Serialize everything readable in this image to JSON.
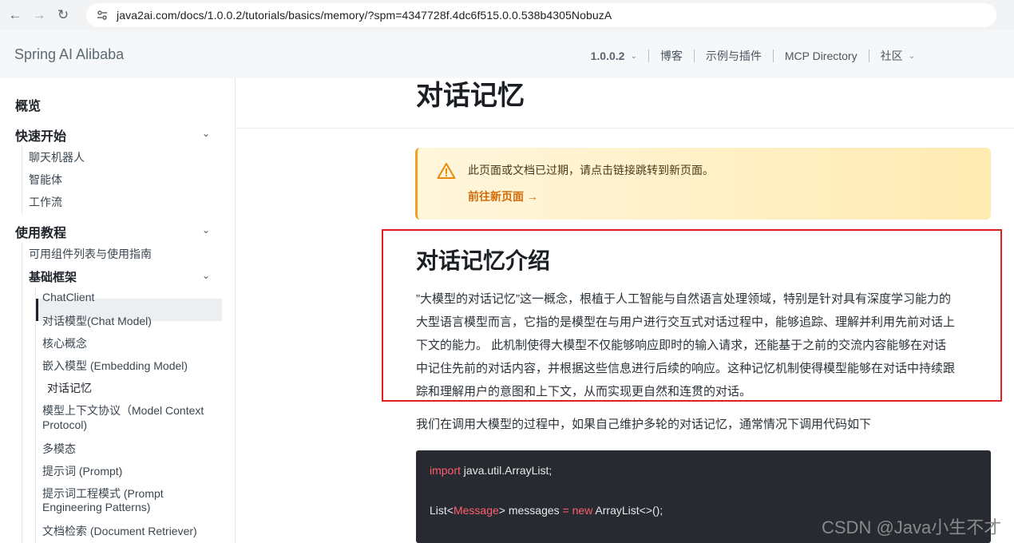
{
  "browser": {
    "url": "java2ai.com/docs/1.0.0.2/tutorials/basics/memory/?spm=4347728f.4dc6f515.0.0.538b4305NobuzA"
  },
  "header": {
    "brand": "Spring AI Alibaba",
    "nav": {
      "version": "1.0.0.2",
      "blog": "博客",
      "examples": "示例与插件",
      "mcp": "MCP Directory",
      "community": "社区"
    }
  },
  "sidebar": {
    "overview": "概览",
    "quickstart": "快速开始",
    "quickstart_items": [
      "聊天机器人",
      "智能体",
      "工作流"
    ],
    "tutorials": "使用教程",
    "components": "可用组件列表与使用指南",
    "basics": "基础框架",
    "basics_items": [
      "ChatClient",
      "对话模型(Chat Model)",
      "核心概念",
      "嵌入模型 (Embedding Model)",
      "对话记忆",
      "模型上下文协议（Model Context",
      "Protocol)",
      "多模态",
      "提示词 (Prompt)",
      "提示词工程模式 (Prompt",
      "Engineering Patterns)",
      "文档检索 (Document Retriever)"
    ]
  },
  "main": {
    "title": "对话记忆",
    "notice": {
      "text": "此页面或文档已过期，请点击链接跳转到新页面。",
      "link": "前往新页面 →"
    },
    "section_title": "对话记忆介绍",
    "paragraph_lines": [
      "”大模型的对话记忆”这一概念，根植于人工智能与自然语言处理领域，特别是针对具有深度学习能力的",
      "大型语言模型而言，它指的是模型在与用户进行交互式对话过程中，能够追踪、理解并利用先前对话上",
      "下文的能力。 此机制使得大模型不仅能够响应即时的输入请求，还能基于之前的交流内容能够在对话",
      "中记住先前的对话内容，并根据这些信息进行后续的响应。这种记忆机制使得模型能够在对话中持续跟",
      "踪和理解用户的意图和上下文，从而实现更自然和连贯的对话。"
    ],
    "paragraph2": "我们在调用大模型的过程中，如果自己维护多轮的对话记忆，通常情况下调用代码如下",
    "code": {
      "line1_kw": "import",
      "line1_rest": " java.util.ArrayList;",
      "line2_a": "List<",
      "line2_type": "Message",
      "line2_b": "> messages ",
      "line2_eq": "=",
      "line2_new": " new",
      "line2_c": " ArrayList<>();"
    }
  },
  "watermark": "CSDN @Java小生不才",
  "colors": {
    "accent_warning": "#f0a020",
    "link_orange": "#d46b08",
    "highlight_red": "#e02020",
    "code_bg": "#272a30",
    "keyword": "#ff5f6d"
  }
}
